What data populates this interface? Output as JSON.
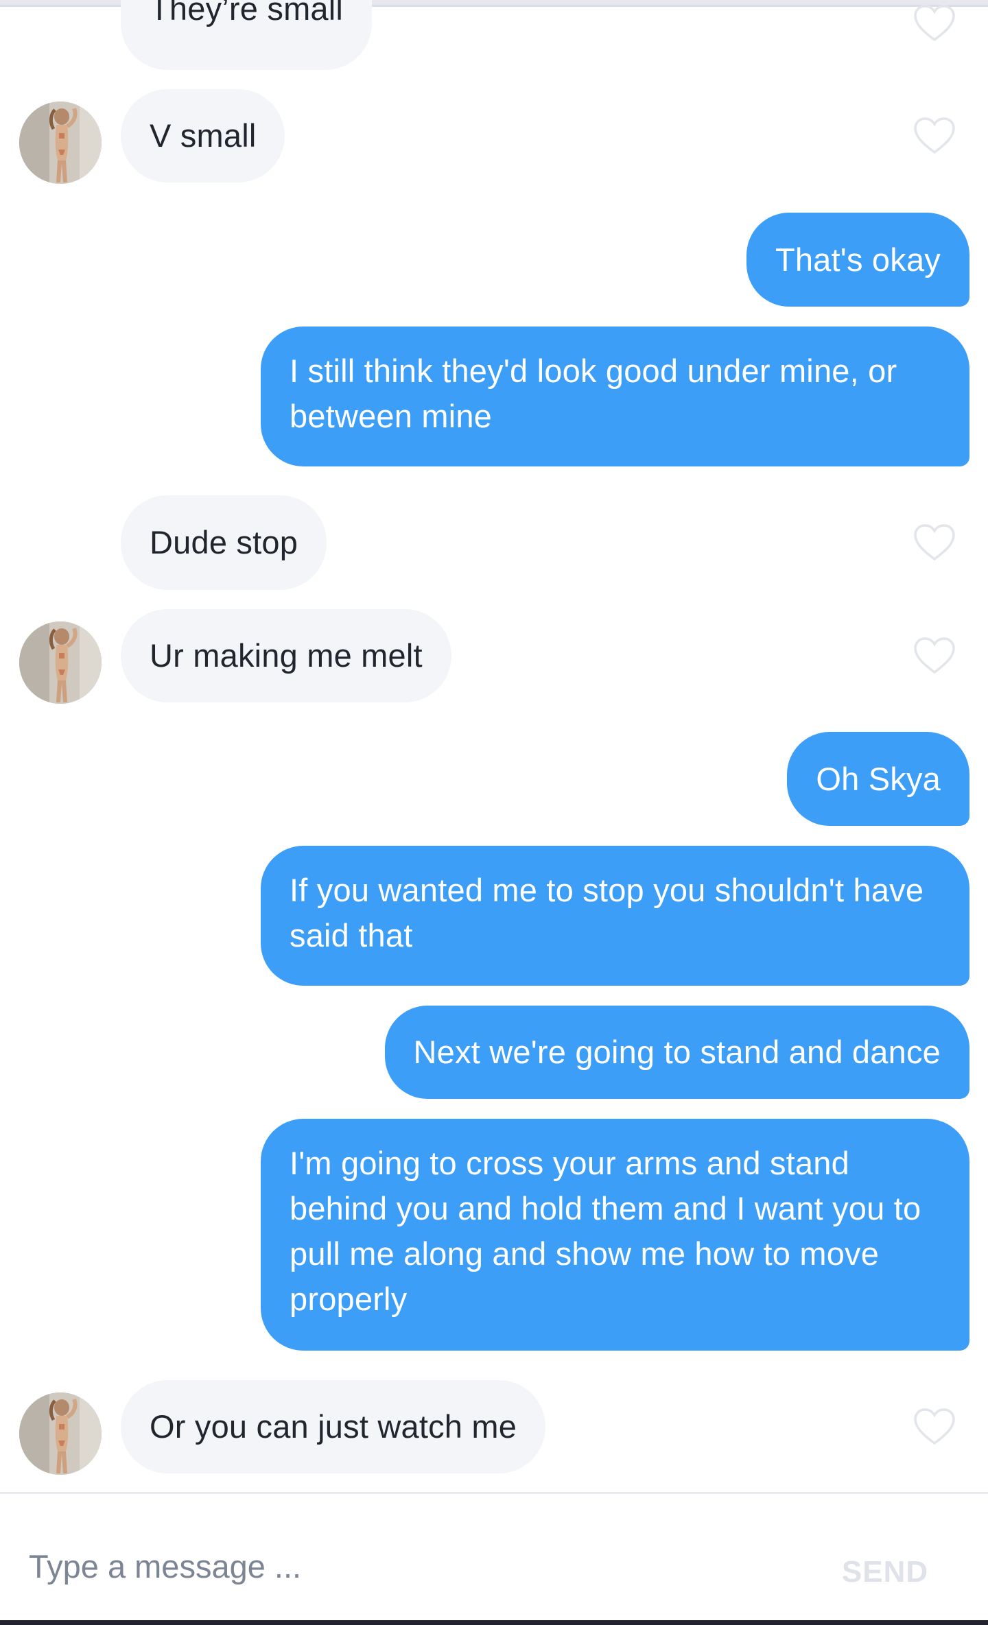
{
  "colors": {
    "outgoing_bubble": "#3d9ef8",
    "incoming_bubble": "#f4f5f9",
    "incoming_text": "#21262e",
    "outgoing_text": "#ffffff",
    "heart_outline": "#e2e5ea",
    "placeholder": "#7c8594",
    "send_disabled": "#dfe3e9"
  },
  "messages": [
    {
      "direction": "incoming",
      "text": "They’re small",
      "avatar": false,
      "like_icon": "heart-outline-icon"
    },
    {
      "direction": "incoming",
      "text": "V small",
      "avatar": true,
      "like_icon": "heart-outline-icon"
    },
    {
      "direction": "outgoing",
      "text": "That's okay"
    },
    {
      "direction": "outgoing",
      "text": "I still think they'd look good under mine, or between mine"
    },
    {
      "direction": "incoming",
      "text": "Dude stop",
      "avatar": false,
      "like_icon": "heart-outline-icon"
    },
    {
      "direction": "incoming",
      "text": "Ur making me melt",
      "avatar": true,
      "like_icon": "heart-outline-icon"
    },
    {
      "direction": "outgoing",
      "text": "Oh Skya"
    },
    {
      "direction": "outgoing",
      "text": "If you wanted me to stop you shouldn't have said that"
    },
    {
      "direction": "outgoing",
      "text": "Next we're going to stand and dance"
    },
    {
      "direction": "outgoing",
      "text": "I'm going to cross your arms and stand behind you and hold them and I want you to pull me along and show me how to move properly"
    },
    {
      "direction": "incoming",
      "text": "Or you can just watch me",
      "avatar": true,
      "like_icon": "heart-outline-icon"
    }
  ],
  "composer": {
    "placeholder": "Type a message ...",
    "value": "",
    "send_label": "SEND"
  }
}
